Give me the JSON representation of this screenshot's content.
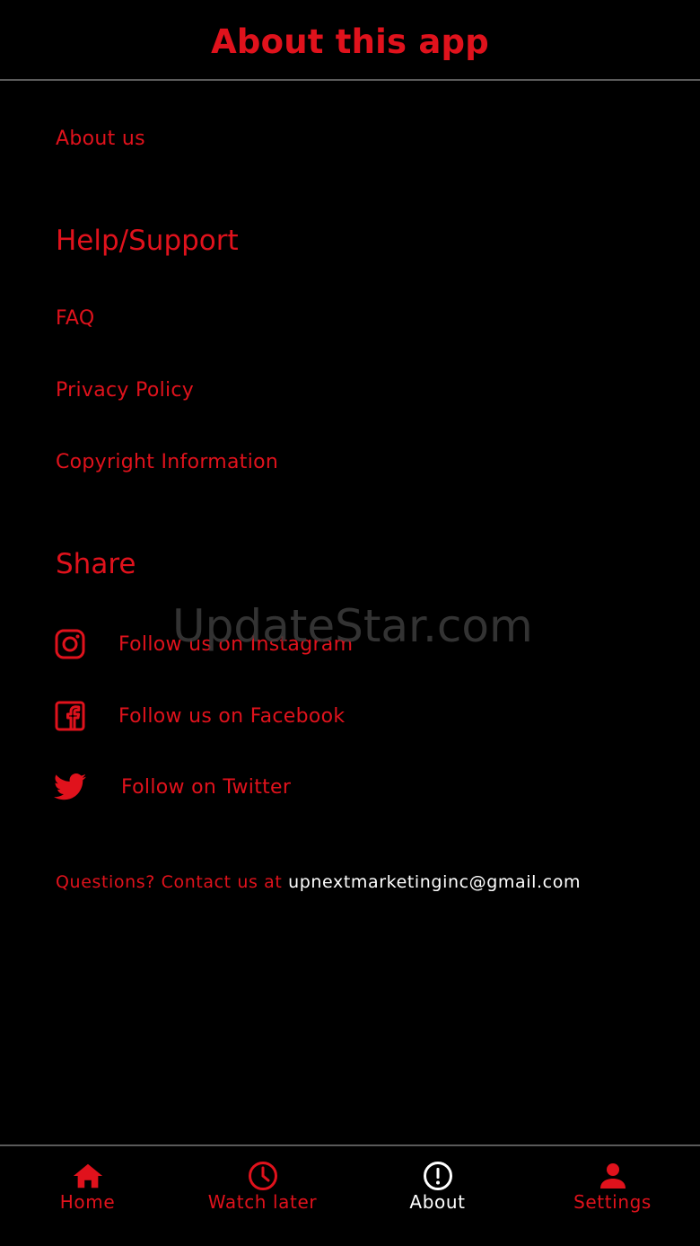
{
  "header": {
    "title": "About this app"
  },
  "links": {
    "about_us": "About us",
    "faq": "FAQ",
    "privacy_policy": "Privacy Policy",
    "copyright_info": "Copyright Information"
  },
  "sections": {
    "help_support": "Help/Support",
    "share": "Share"
  },
  "social": {
    "instagram": {
      "label": "Follow us on Instagram",
      "icon": "instagram-icon"
    },
    "facebook": {
      "label": "Follow us on Facebook",
      "icon": "facebook-icon"
    },
    "twitter": {
      "label": "Follow on Twitter",
      "icon": "twitter-icon"
    }
  },
  "contact": {
    "prefix": "Questions? Contact us at",
    "email": "upnextmarketinginc@gmail.com"
  },
  "watermark": "UpdateStar.com",
  "tabbar": {
    "tabs": [
      {
        "label": "Home",
        "icon": "home-icon",
        "active": false
      },
      {
        "label": "Watch later",
        "icon": "clock-icon",
        "active": false
      },
      {
        "label": "About",
        "icon": "info-icon",
        "active": true
      },
      {
        "label": "Settings",
        "icon": "person-icon",
        "active": false
      }
    ]
  },
  "colors": {
    "accent": "#e0121c",
    "background": "#000000",
    "active_tab": "#ffffff",
    "divider": "#5a5a5a"
  }
}
